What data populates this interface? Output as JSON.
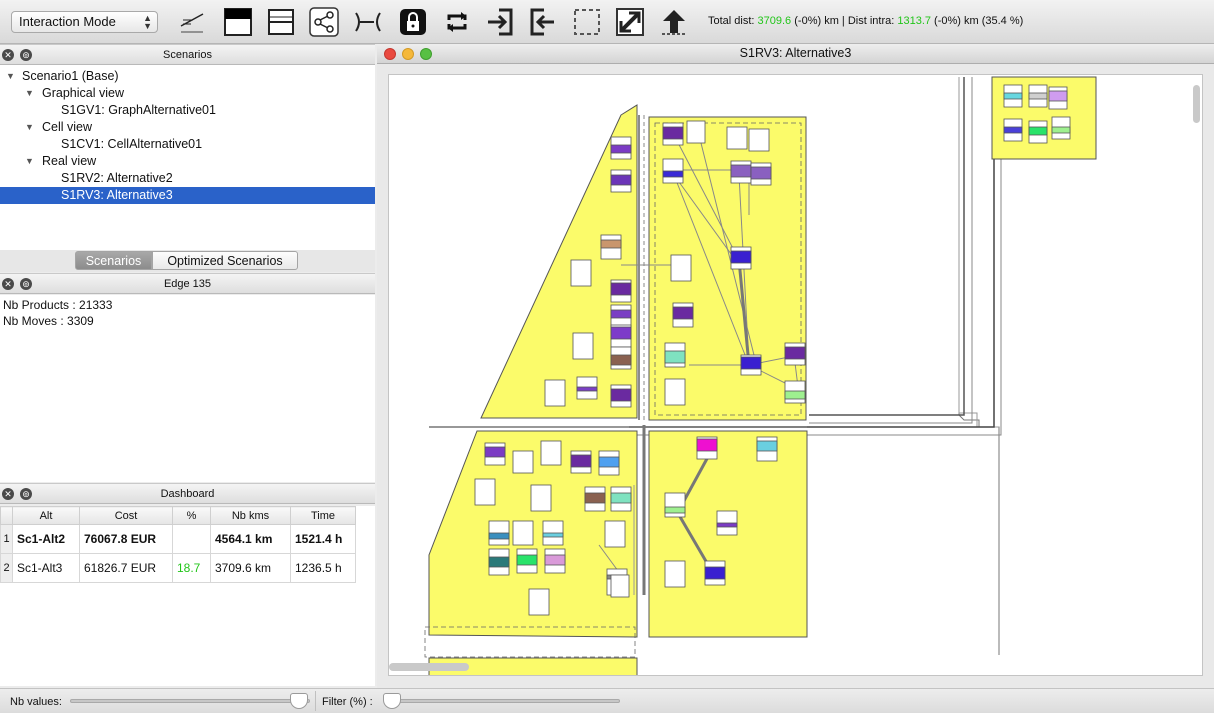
{
  "toolbar": {
    "mode": "Interaction Mode",
    "stats_prefix": "Total dist: ",
    "total_dist": "3709.6",
    "stats_mid1": " (-0%) km | Dist intra: ",
    "dist_intra": "1313.7",
    "stats_mid2": " (-0%) km (35.4 %)",
    "icons": [
      "pencil-icon",
      "black-box-icon",
      "split-box-icon",
      "share-icon",
      "edge-icon",
      "lock-icon",
      "loop-icon",
      "import-icon",
      "export-icon",
      "select-icon",
      "expand-icon",
      "upload-icon"
    ]
  },
  "scenarios_panel": {
    "title": "Scenarios",
    "items": [
      {
        "label": "Scenario1 (Base)"
      },
      {
        "label": "Graphical view"
      },
      {
        "label": "S1GV1: GraphAlternative01"
      },
      {
        "label": "Cell view"
      },
      {
        "label": "S1CV1: CellAlternative01"
      },
      {
        "label": "Real view"
      },
      {
        "label": "S1RV2: Alternative2"
      },
      {
        "label": "S1RV3: Alternative3"
      }
    ],
    "tabs": [
      "Scenarios",
      "Optimized Scenarios"
    ]
  },
  "edge_panel": {
    "title": "Edge 135",
    "lines": [
      "Nb Products : 21333",
      "Nb Moves : 3309"
    ]
  },
  "dashboard": {
    "title": "Dashboard",
    "columns": [
      "Alt",
      "Cost",
      "%",
      "Nb kms",
      "Time"
    ],
    "rows": [
      {
        "idx": "1",
        "alt": "Sc1-Alt2",
        "cost": "76067.8 EUR",
        "pct": "",
        "kms": "4564.1 km",
        "time": "1521.4 h"
      },
      {
        "idx": "2",
        "alt": "Sc1-Alt3",
        "cost": "61826.7 EUR",
        "pct": "18.7",
        "kms": "3709.6 km",
        "time": "1236.5 h"
      }
    ]
  },
  "bottom": {
    "nb_values_label": "Nb values:",
    "filter_label": "Filter (%) :"
  },
  "window": {
    "title": "S1RV3: Alternative3"
  },
  "colors": {
    "zone_fill": "#fbfb6a",
    "selection": "#2a62c9",
    "accent_green": "#22c51a"
  }
}
